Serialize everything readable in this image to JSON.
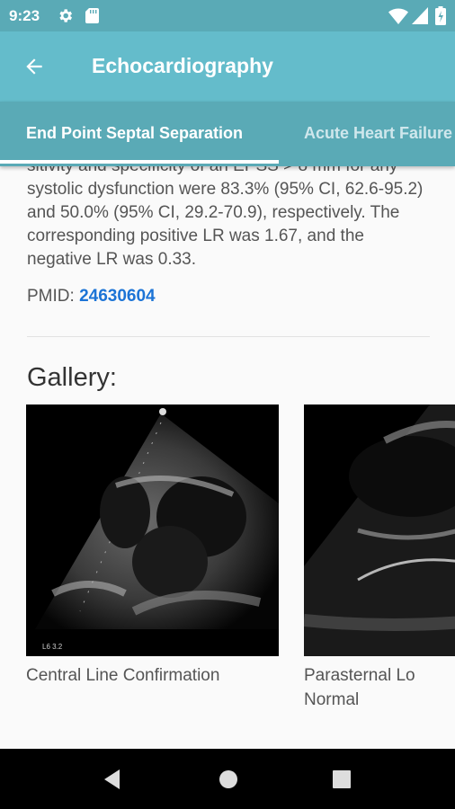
{
  "status_bar": {
    "time": "9:23",
    "icons": [
      "gear-icon",
      "sd-card-icon",
      "wifi-icon",
      "signal-icon",
      "battery-icon"
    ]
  },
  "app_bar": {
    "title": "Echocardiography",
    "back_icon": "arrow-back-icon",
    "color": "#64bccb"
  },
  "tabs": [
    {
      "label": "End Point Septal Separation",
      "active": true
    },
    {
      "label": "Acute Heart Failure",
      "active": false
    }
  ],
  "content": {
    "abstract_text": "sitivity and specificity of an EPSS > 8 mm for any systolic dysfunction were 83.3% (95% CI, 62.6-95.2) and 50.0% (95% CI, 29.2-70.9), respectively. The corresponding positive LR was 1.67, and the negative LR was 0.33.",
    "pmid_label": "PMID: ",
    "pmid_value": "24630604",
    "link_color": "#1c74d6"
  },
  "gallery": {
    "heading": "Gallery:",
    "items": [
      {
        "caption": "Central Line Confirmation",
        "image_icon": "ultrasound-image"
      },
      {
        "caption": "Parasternal Lo\nNormal",
        "image_icon": "ultrasound-image"
      }
    ]
  },
  "nav_bar": {
    "icons": [
      "nav-back-icon",
      "nav-home-icon",
      "nav-recents-icon"
    ]
  }
}
